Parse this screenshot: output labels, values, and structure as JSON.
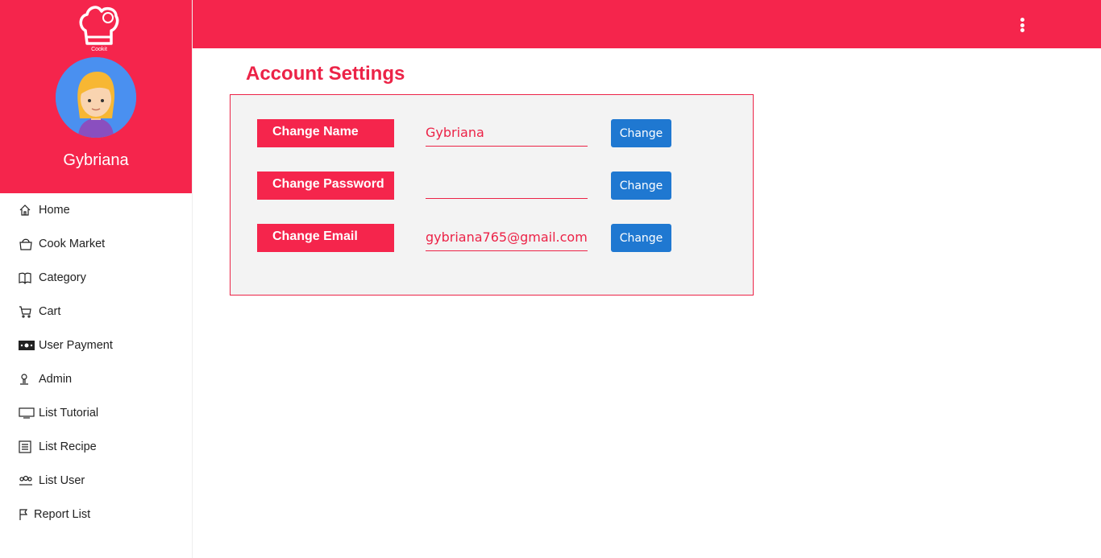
{
  "header": {
    "menu_icon": "kebab-vertical-icon"
  },
  "brand": {
    "logo_icon": "chef-hat-logo",
    "logo_text": "Cookit"
  },
  "profile": {
    "username": "Gybriana",
    "avatar_icon": "user-avatar"
  },
  "sidebar": {
    "items": [
      {
        "label": "Home",
        "icon": "home-icon"
      },
      {
        "label": "Cook Market",
        "icon": "shopping-bag-icon"
      },
      {
        "label": "Category",
        "icon": "book-icon"
      },
      {
        "label": "Cart",
        "icon": "cart-icon"
      },
      {
        "label": "User Payment",
        "icon": "money-icon"
      },
      {
        "label": "Admin",
        "icon": "user-icon"
      },
      {
        "label": "List Tutorial",
        "icon": "monitor-icon"
      },
      {
        "label": "List Recipe",
        "icon": "list-icon"
      },
      {
        "label": "List User",
        "icon": "users-icon"
      },
      {
        "label": "Report List",
        "icon": "flag-icon"
      }
    ]
  },
  "main": {
    "title": "Account Settings",
    "rows": [
      {
        "label": "Change Name",
        "value": "Gybriana",
        "button": "Change"
      },
      {
        "label": "Change Password",
        "value": "",
        "button": "Change"
      },
      {
        "label": "Change Email",
        "value": "gybriana765@gmail.com",
        "button": "Change"
      }
    ]
  },
  "colors": {
    "primary": "#f5254c",
    "button": "#1f78d1",
    "card_bg": "#f3f3f3"
  }
}
